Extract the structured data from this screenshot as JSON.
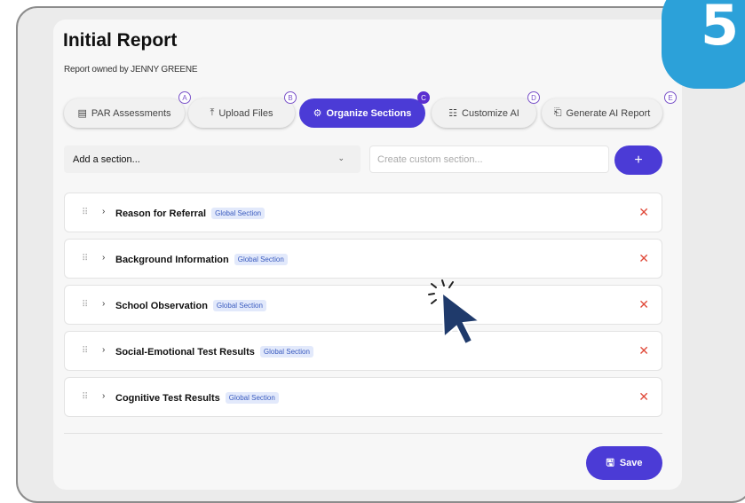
{
  "page": {
    "title": "Initial Report",
    "owner_text": "Report owned by JENNY GREENE"
  },
  "tabs": [
    {
      "label": "PAR Assessments",
      "icon": "clipboard-icon",
      "step": "A",
      "active": false
    },
    {
      "label": "Upload Files",
      "icon": "upload-icon",
      "step": "B",
      "active": false
    },
    {
      "label": "Organize Sections",
      "icon": "gear-icon",
      "step": "C",
      "active": true
    },
    {
      "label": "Customize AI",
      "icon": "sliders-icon",
      "step": "D",
      "active": false
    },
    {
      "label": "Generate AI Report",
      "icon": "document-icon",
      "step": "E",
      "active": false
    }
  ],
  "add_section": {
    "select_value": "Add a section...",
    "custom_placeholder": "Create custom section...",
    "add_button": "+"
  },
  "sections": [
    {
      "label": "Reason for Referral",
      "badge": "Global Section"
    },
    {
      "label": "Background Information",
      "badge": "Global Section"
    },
    {
      "label": "School Observation",
      "badge": "Global Section"
    },
    {
      "label": "Social-Emotional Test Results",
      "badge": "Global Section"
    },
    {
      "label": "Cognitive Test Results",
      "badge": "Global Section"
    }
  ],
  "save_label": "Save",
  "step_number": "5",
  "colors": {
    "accent": "#4b3bd6",
    "delete": "#e04a3a",
    "badge_bg": "#e2e9fb",
    "step_badge": "#2ca1d9"
  }
}
